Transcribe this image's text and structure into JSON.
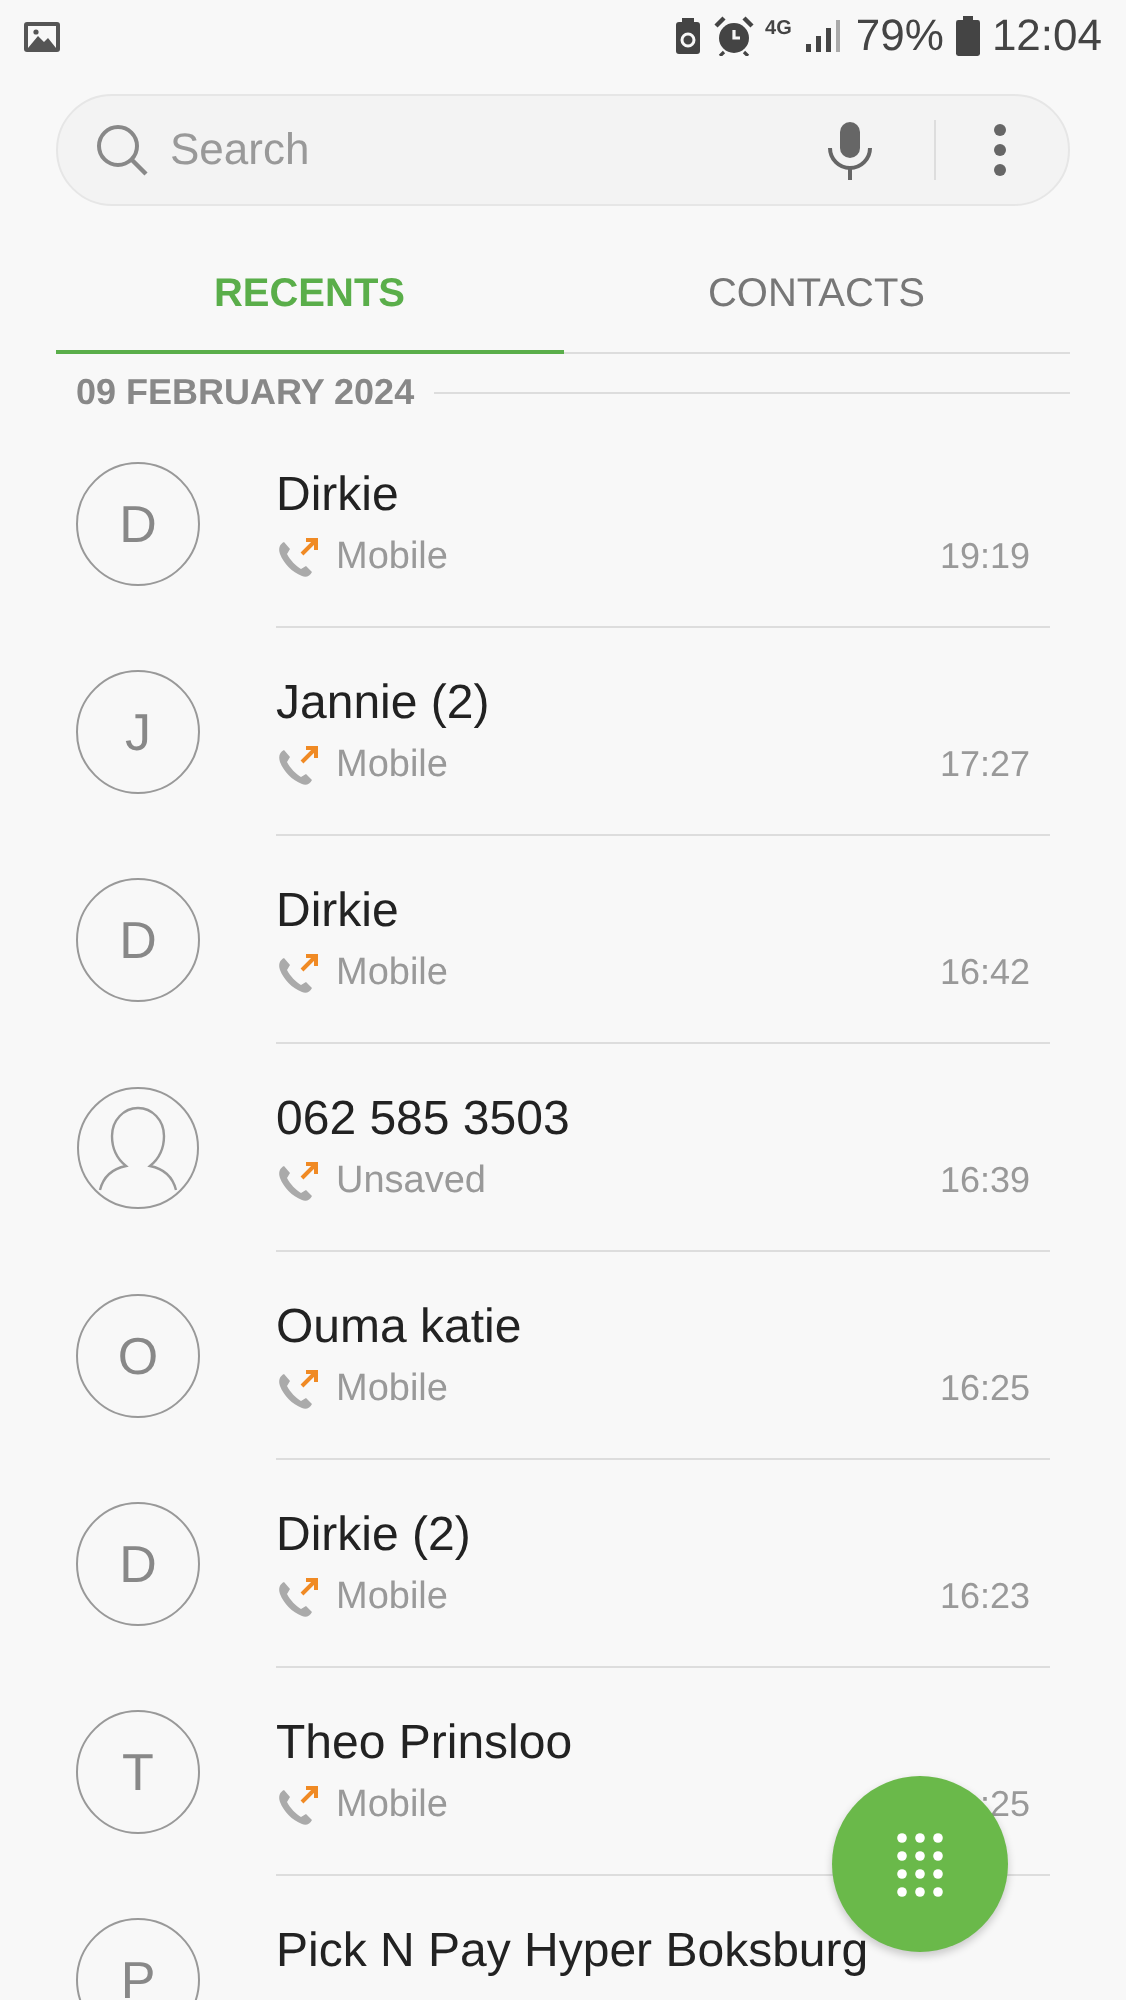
{
  "status_bar": {
    "battery": "79%",
    "network": "4G",
    "time": "12:04"
  },
  "search": {
    "placeholder": "Search"
  },
  "tabs": [
    {
      "label": "RECENTS",
      "selected": true
    },
    {
      "label": "CONTACTS",
      "selected": false
    }
  ],
  "date_header": "09 FEBRUARY 2024",
  "calls": [
    {
      "avatar": {
        "kind": "letter",
        "letter": "D"
      },
      "name": "Dirkie",
      "type": "Mobile",
      "time": "19:19"
    },
    {
      "avatar": {
        "kind": "letter",
        "letter": "J"
      },
      "name": "Jannie (2)",
      "type": "Mobile",
      "time": "17:27"
    },
    {
      "avatar": {
        "kind": "letter",
        "letter": "D"
      },
      "name": "Dirkie",
      "type": "Mobile",
      "time": "16:42"
    },
    {
      "avatar": {
        "kind": "silhouette"
      },
      "name": "062 585 3503",
      "type": "Unsaved",
      "time": "16:39"
    },
    {
      "avatar": {
        "kind": "letter",
        "letter": "O"
      },
      "name": "Ouma katie",
      "type": "Mobile",
      "time": "16:25"
    },
    {
      "avatar": {
        "kind": "letter",
        "letter": "D"
      },
      "name": "Dirkie (2)",
      "type": "Mobile",
      "time": "16:23"
    },
    {
      "avatar": {
        "kind": "letter",
        "letter": "T"
      },
      "name": "Theo Prinsloo",
      "type": "Mobile",
      "time": ":25"
    },
    {
      "avatar": {
        "kind": "letter",
        "letter": "P"
      },
      "name": "Pick N Pay Hyper Boksburg"
    }
  ]
}
